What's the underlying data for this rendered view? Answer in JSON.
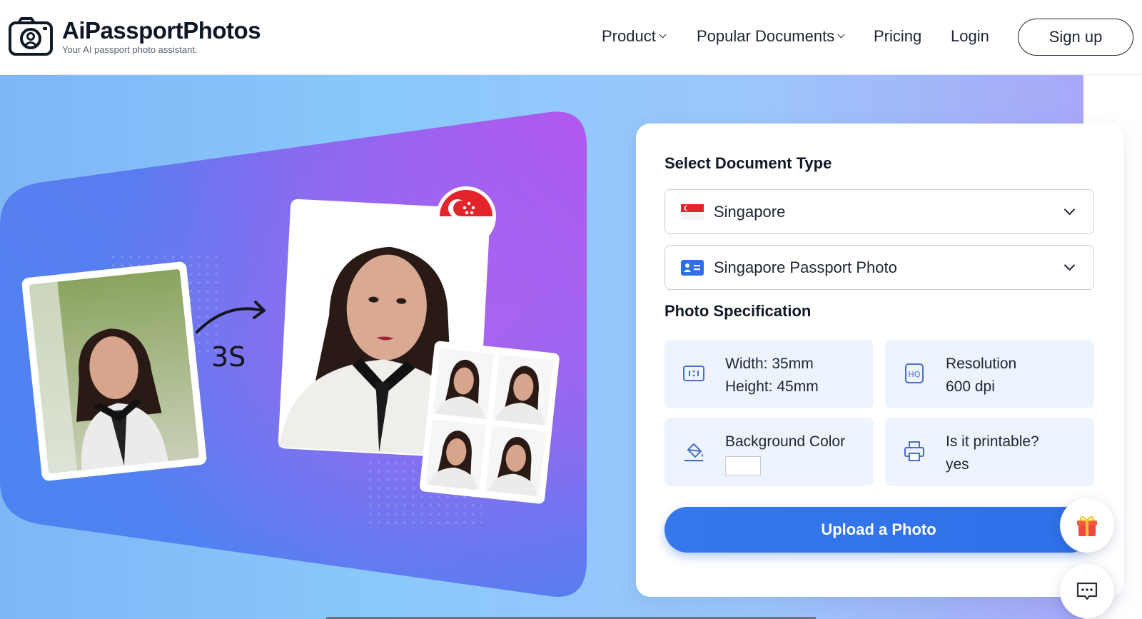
{
  "brand": {
    "title": "AiPassportPhotos",
    "tagline": "Your AI passport photo assistant."
  },
  "nav": {
    "items": [
      {
        "label": "Product",
        "has_dropdown": true
      },
      {
        "label": "Popular Documents",
        "has_dropdown": true
      },
      {
        "label": "Pricing",
        "has_dropdown": false
      },
      {
        "label": "Login",
        "has_dropdown": false
      }
    ],
    "signup_label": "Sign up"
  },
  "hero": {
    "speed_label": "3S"
  },
  "form": {
    "heading": "Select Document Type",
    "country": {
      "value": "Singapore",
      "flag_icon": "singapore-flag-icon"
    },
    "document": {
      "value": "Singapore Passport Photo",
      "icon": "id-card-icon"
    },
    "spec_heading": "Photo Specification",
    "specs": {
      "size_line1": "Width: 35mm",
      "size_line2": "Height: 45mm",
      "resolution_line1": "Resolution",
      "resolution_line2": "600 dpi",
      "background_label": "Background Color",
      "background_color": "#ffffff",
      "printable_line1": "Is it printable?",
      "printable_line2": "yes"
    },
    "upload_label": "Upload a Photo"
  },
  "colors": {
    "accent": "#2f6fe8",
    "spec_bg": "#edf4fd",
    "hero_panel_start": "#3f7cf0",
    "hero_panel_end": "#b35cf0"
  }
}
